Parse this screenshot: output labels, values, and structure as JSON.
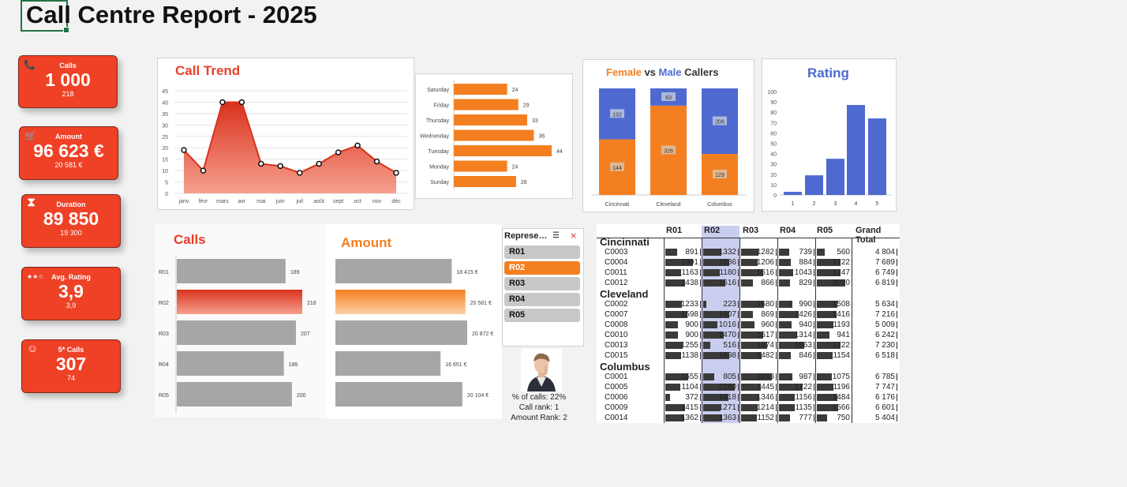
{
  "title": "Call Centre Report - 2025",
  "colors": {
    "accent": "#ee4126",
    "orange": "#f47f20",
    "blue": "#4e6ad0",
    "grey": "#a6a6a6"
  },
  "kpis": [
    {
      "icon": "phone-icon",
      "glyph": "📞",
      "label": "Calls",
      "value": "1 000",
      "sub": "218"
    },
    {
      "icon": "cart-icon",
      "glyph": "🛒",
      "label": "Amount",
      "value": "96 623 €",
      "sub": "20 581 €"
    },
    {
      "icon": "hourglass-icon",
      "glyph": "⧗",
      "label": "Duration",
      "value": "89 850",
      "sub": "19 300"
    },
    {
      "icon": "stars-icon",
      "glyph": "★★☆",
      "label": "Avg. Rating",
      "value": "3,9",
      "sub": "3,9"
    },
    {
      "icon": "smiley-icon",
      "glyph": "☺",
      "label": "5* Calls",
      "value": "307",
      "sub": "74"
    }
  ],
  "call_trend_title": "Call Trend",
  "female_word": "Female",
  "vs_word": "vs",
  "male_word": "Male",
  "callers_word": "Callers",
  "rating_title": "Rating",
  "calls_bars_title": "Calls",
  "amount_bars_title": "Amount",
  "rep_info": {
    "pct": "% of calls: 22%",
    "call_rank": "Call rank: 1",
    "amount_rank": "Amount Rank: 2"
  },
  "slicer": {
    "header": "Represe…",
    "items": [
      "R01",
      "R02",
      "R03",
      "R04",
      "R05"
    ],
    "selected": "R02"
  },
  "chart_data": [
    {
      "type": "area",
      "title": "Call Trend",
      "categories": [
        "janv",
        "févr",
        "mars",
        "avr",
        "mai",
        "juin",
        "juil",
        "août",
        "sept",
        "oct",
        "nov",
        "déc"
      ],
      "values": [
        19,
        10,
        40,
        40,
        13,
        12,
        9,
        13,
        18,
        21,
        14,
        9
      ],
      "ylim": [
        0,
        45
      ],
      "yticks": [
        0,
        5,
        10,
        15,
        20,
        25,
        30,
        35,
        40,
        45
      ],
      "grid": true
    },
    {
      "type": "bar",
      "orientation": "horizontal",
      "categories": [
        "Saturday",
        "Friday",
        "Thursday",
        "Wednesday",
        "Tuesday",
        "Monday",
        "Sunday"
      ],
      "values": [
        24,
        29,
        33,
        36,
        44,
        24,
        28
      ]
    },
    {
      "type": "bar",
      "stacked": true,
      "title": "Female vs Male Callers",
      "categories": [
        "Cincinnati",
        "Cleveland",
        "Columbus"
      ],
      "series": [
        {
          "name": "Female",
          "values": [
            144,
            326,
            129
          ]
        },
        {
          "name": "Male",
          "values": [
            132,
            63,
            206
          ]
        }
      ]
    },
    {
      "type": "bar",
      "title": "Rating",
      "categories": [
        "1",
        "2",
        "3",
        "4",
        "5"
      ],
      "values": [
        3,
        19,
        35,
        87,
        74
      ],
      "ylim": [
        0,
        100
      ],
      "yticks": [
        0,
        10,
        20,
        30,
        40,
        50,
        60,
        70,
        80,
        90,
        100
      ]
    },
    {
      "type": "bar",
      "orientation": "horizontal",
      "title": "Calls",
      "categories": [
        "R01",
        "R02",
        "R03",
        "R04",
        "R05"
      ],
      "values": [
        189,
        218,
        207,
        186,
        200
      ],
      "highlight": "R02"
    },
    {
      "type": "bar",
      "orientation": "horizontal",
      "title": "Amount",
      "categories": [
        "R01",
        "R02",
        "R03",
        "R04",
        "R05"
      ],
      "values": [
        18415,
        20581,
        20872,
        16651,
        20104
      ],
      "labels": [
        "18 415 €",
        "20 581 €",
        "20 872 €",
        "16 651 €",
        "20 104 €"
      ],
      "highlight": "R02"
    },
    {
      "type": "table",
      "columns": [
        "R01",
        "R02",
        "R03",
        "R04",
        "R05",
        "Grand Total"
      ],
      "groups": [
        {
          "name": "Cincinnati",
          "rows": [
            {
              "code": "C0003",
              "values": [
                891,
                1332,
                1282,
                739,
                560
              ],
              "total": "4 804"
            },
            {
              "code": "C0004",
              "values": [
                1991,
                1886,
                1206,
                884,
                1722
              ],
              "total": "7 689"
            },
            {
              "code": "C0011",
              "values": [
                1163,
                1180,
                1616,
                1043,
                1747
              ],
              "total": "6 749"
            },
            {
              "code": "C0012",
              "values": [
                1438,
                1616,
                866,
                829,
                2070
              ],
              "total": "6 819"
            }
          ]
        },
        {
          "name": "Cleveland",
          "rows": [
            {
              "code": "C0002",
              "values": [
                1233,
                223,
                1680,
                990,
                1508
              ],
              "total": "5 634"
            },
            {
              "code": "C0007",
              "values": [
                1598,
                1907,
                869,
                1426,
                1416
              ],
              "total": "7 216"
            },
            {
              "code": "C0008",
              "values": [
                900,
                1016,
                960,
                940,
                1193
              ],
              "total": "5 009"
            },
            {
              "code": "C0010",
              "values": [
                900,
                1470,
                1617,
                1314,
                941
              ],
              "total": "6 242"
            },
            {
              "code": "C0013",
              "values": [
                1255,
                516,
                1874,
                1863,
                1722
              ],
              "total": "7 230"
            },
            {
              "code": "C0015",
              "values": [
                1138,
                1898,
                1482,
                846,
                1154
              ],
              "total": "6 518"
            }
          ]
        },
        {
          "name": "Columbus",
          "rows": [
            {
              "code": "C0001",
              "values": [
                1655,
                805,
                2263,
                987,
                1075
              ],
              "total": "6 785"
            },
            {
              "code": "C0005",
              "values": [
                1104,
                2280,
                1445,
                1722,
                1196
              ],
              "total": "7 747"
            },
            {
              "code": "C0006",
              "values": [
                372,
                1818,
                1346,
                1156,
                1484
              ],
              "total": "6 176"
            },
            {
              "code": "C0009",
              "values": [
                1415,
                1271,
                1214,
                1135,
                1566
              ],
              "total": "6 601"
            },
            {
              "code": "C0014",
              "values": [
                1362,
                1363,
                1152,
                777,
                750
              ],
              "total": "5 404"
            }
          ]
        }
      ]
    }
  ]
}
